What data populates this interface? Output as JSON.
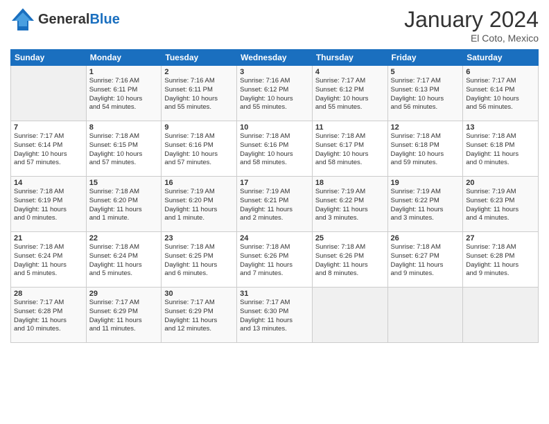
{
  "header": {
    "logo_general": "General",
    "logo_blue": "Blue",
    "month_year": "January 2024",
    "location": "El Coto, Mexico"
  },
  "days_of_week": [
    "Sunday",
    "Monday",
    "Tuesday",
    "Wednesday",
    "Thursday",
    "Friday",
    "Saturday"
  ],
  "weeks": [
    [
      {
        "day": "",
        "info": ""
      },
      {
        "day": "1",
        "info": "Sunrise: 7:16 AM\nSunset: 6:11 PM\nDaylight: 10 hours\nand 54 minutes."
      },
      {
        "day": "2",
        "info": "Sunrise: 7:16 AM\nSunset: 6:11 PM\nDaylight: 10 hours\nand 55 minutes."
      },
      {
        "day": "3",
        "info": "Sunrise: 7:16 AM\nSunset: 6:12 PM\nDaylight: 10 hours\nand 55 minutes."
      },
      {
        "day": "4",
        "info": "Sunrise: 7:17 AM\nSunset: 6:12 PM\nDaylight: 10 hours\nand 55 minutes."
      },
      {
        "day": "5",
        "info": "Sunrise: 7:17 AM\nSunset: 6:13 PM\nDaylight: 10 hours\nand 56 minutes."
      },
      {
        "day": "6",
        "info": "Sunrise: 7:17 AM\nSunset: 6:14 PM\nDaylight: 10 hours\nand 56 minutes."
      }
    ],
    [
      {
        "day": "7",
        "info": "Sunrise: 7:17 AM\nSunset: 6:14 PM\nDaylight: 10 hours\nand 57 minutes."
      },
      {
        "day": "8",
        "info": "Sunrise: 7:18 AM\nSunset: 6:15 PM\nDaylight: 10 hours\nand 57 minutes."
      },
      {
        "day": "9",
        "info": "Sunrise: 7:18 AM\nSunset: 6:16 PM\nDaylight: 10 hours\nand 57 minutes."
      },
      {
        "day": "10",
        "info": "Sunrise: 7:18 AM\nSunset: 6:16 PM\nDaylight: 10 hours\nand 58 minutes."
      },
      {
        "day": "11",
        "info": "Sunrise: 7:18 AM\nSunset: 6:17 PM\nDaylight: 10 hours\nand 58 minutes."
      },
      {
        "day": "12",
        "info": "Sunrise: 7:18 AM\nSunset: 6:18 PM\nDaylight: 10 hours\nand 59 minutes."
      },
      {
        "day": "13",
        "info": "Sunrise: 7:18 AM\nSunset: 6:18 PM\nDaylight: 11 hours\nand 0 minutes."
      }
    ],
    [
      {
        "day": "14",
        "info": "Sunrise: 7:18 AM\nSunset: 6:19 PM\nDaylight: 11 hours\nand 0 minutes."
      },
      {
        "day": "15",
        "info": "Sunrise: 7:18 AM\nSunset: 6:20 PM\nDaylight: 11 hours\nand 1 minute."
      },
      {
        "day": "16",
        "info": "Sunrise: 7:19 AM\nSunset: 6:20 PM\nDaylight: 11 hours\nand 1 minute."
      },
      {
        "day": "17",
        "info": "Sunrise: 7:19 AM\nSunset: 6:21 PM\nDaylight: 11 hours\nand 2 minutes."
      },
      {
        "day": "18",
        "info": "Sunrise: 7:19 AM\nSunset: 6:22 PM\nDaylight: 11 hours\nand 3 minutes."
      },
      {
        "day": "19",
        "info": "Sunrise: 7:19 AM\nSunset: 6:22 PM\nDaylight: 11 hours\nand 3 minutes."
      },
      {
        "day": "20",
        "info": "Sunrise: 7:19 AM\nSunset: 6:23 PM\nDaylight: 11 hours\nand 4 minutes."
      }
    ],
    [
      {
        "day": "21",
        "info": "Sunrise: 7:18 AM\nSunset: 6:24 PM\nDaylight: 11 hours\nand 5 minutes."
      },
      {
        "day": "22",
        "info": "Sunrise: 7:18 AM\nSunset: 6:24 PM\nDaylight: 11 hours\nand 5 minutes."
      },
      {
        "day": "23",
        "info": "Sunrise: 7:18 AM\nSunset: 6:25 PM\nDaylight: 11 hours\nand 6 minutes."
      },
      {
        "day": "24",
        "info": "Sunrise: 7:18 AM\nSunset: 6:26 PM\nDaylight: 11 hours\nand 7 minutes."
      },
      {
        "day": "25",
        "info": "Sunrise: 7:18 AM\nSunset: 6:26 PM\nDaylight: 11 hours\nand 8 minutes."
      },
      {
        "day": "26",
        "info": "Sunrise: 7:18 AM\nSunset: 6:27 PM\nDaylight: 11 hours\nand 9 minutes."
      },
      {
        "day": "27",
        "info": "Sunrise: 7:18 AM\nSunset: 6:28 PM\nDaylight: 11 hours\nand 9 minutes."
      }
    ],
    [
      {
        "day": "28",
        "info": "Sunrise: 7:17 AM\nSunset: 6:28 PM\nDaylight: 11 hours\nand 10 minutes."
      },
      {
        "day": "29",
        "info": "Sunrise: 7:17 AM\nSunset: 6:29 PM\nDaylight: 11 hours\nand 11 minutes."
      },
      {
        "day": "30",
        "info": "Sunrise: 7:17 AM\nSunset: 6:29 PM\nDaylight: 11 hours\nand 12 minutes."
      },
      {
        "day": "31",
        "info": "Sunrise: 7:17 AM\nSunset: 6:30 PM\nDaylight: 11 hours\nand 13 minutes."
      },
      {
        "day": "",
        "info": ""
      },
      {
        "day": "",
        "info": ""
      },
      {
        "day": "",
        "info": ""
      }
    ]
  ]
}
